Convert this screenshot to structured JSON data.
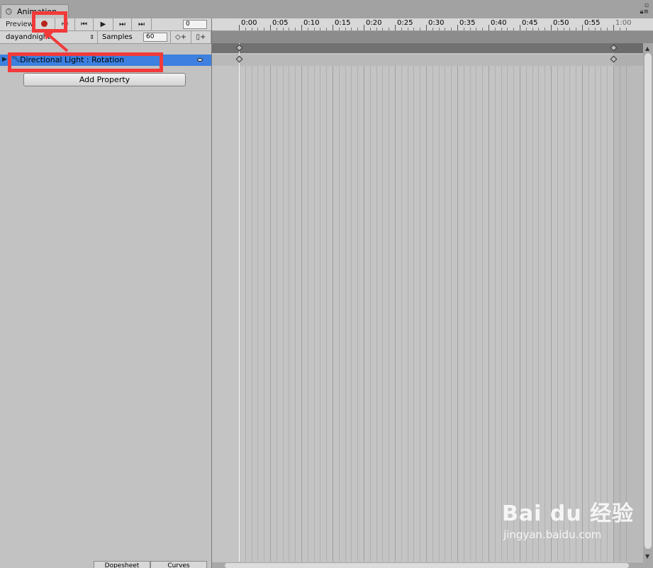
{
  "window": {
    "tab_title": "Animation",
    "tab_icon": "clock-icon",
    "controls": "lock-icon, menu-icon"
  },
  "toolbar": {
    "preview_label": "Preview",
    "current_frame": "0",
    "icons": [
      "record-icon",
      "first-key-icon",
      "prev-key-icon",
      "play-icon",
      "next-key-icon",
      "last-key-icon"
    ],
    "play_glyph": "▶",
    "prev_glyph": "⏮",
    "first_glyph": "⏮",
    "next_glyph": "⏭",
    "last_glyph": "⏭",
    "record_color": "#b5251e"
  },
  "clip": {
    "selected": "dayandnight",
    "samples_label": "Samples",
    "samples_value": "60",
    "add_key_glyph": "◇+",
    "add_event_glyph": "▯+"
  },
  "properties": [
    {
      "label": "Directional Light : Rotation",
      "selected": true
    }
  ],
  "add_property_label": "Add Property",
  "bottom_tabs": [
    "Dopesheet",
    "Curves"
  ],
  "timeline": {
    "ticks": [
      "0:00",
      "0:05",
      "0:10",
      "0:15",
      "0:20",
      "0:25",
      "0:30",
      "0:35",
      "0:40",
      "0:45",
      "0:50",
      "0:55",
      "1:00"
    ],
    "keyframes_seconds": [
      0,
      60
    ]
  },
  "watermark": {
    "brand": "Bai du 经验",
    "url": "jingyan.baidu.com"
  },
  "colors": {
    "selection": "#3d80df",
    "annotation": "#f23a3a"
  }
}
